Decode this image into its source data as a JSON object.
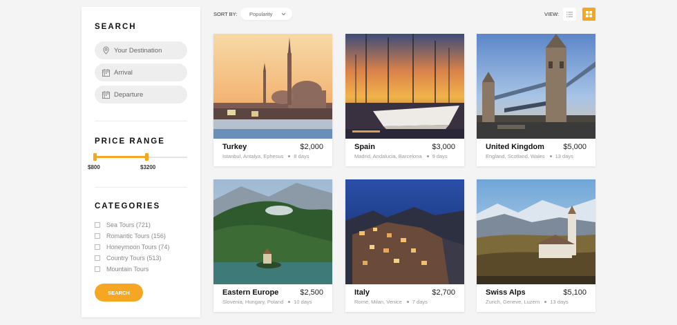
{
  "sidebar": {
    "search_title": "SEARCH",
    "destination_placeholder": "Your Destination",
    "arrival_placeholder": "Arrival",
    "departure_placeholder": "Departure",
    "price_title": "PRICE RANGE",
    "price_min": "$800",
    "price_max": "$3200",
    "categories_title": "CATEGORIES",
    "categories": [
      "Sea Tours (721)",
      "Romantic Tours (156)",
      "Honeymoon Tours (74)",
      "Country Tours (513)",
      "Mountain Tours"
    ],
    "search_button": "SEARCH"
  },
  "toolbar": {
    "sort_label": "SORT BY:",
    "sort_value": "Popularity",
    "view_label": "VIEW:"
  },
  "colors": {
    "accent": "#f5a623"
  },
  "tours": [
    {
      "name": "Turkey",
      "price": "$2,000",
      "places": "Istanbul, Antalya, Ephesus",
      "days": "8 days"
    },
    {
      "name": "Spain",
      "price": "$3,000",
      "places": "Madrid, Andalucia, Barcelona",
      "days": "9 days"
    },
    {
      "name": "United Kingdom",
      "price": "$5,000",
      "places": "England, Scotland, Wales",
      "days": "13 days"
    },
    {
      "name": "Eastern Europe",
      "price": "$2,500",
      "places": "Slovenia, Hungary, Poland",
      "days": "10 days"
    },
    {
      "name": "Italy",
      "price": "$2,700",
      "places": "Rome, Milan, Venice",
      "days": "7 days"
    },
    {
      "name": "Swiss Alps",
      "price": "$5,100",
      "places": "Zurich, Geneve, Luzern",
      "days": "13 days"
    }
  ]
}
